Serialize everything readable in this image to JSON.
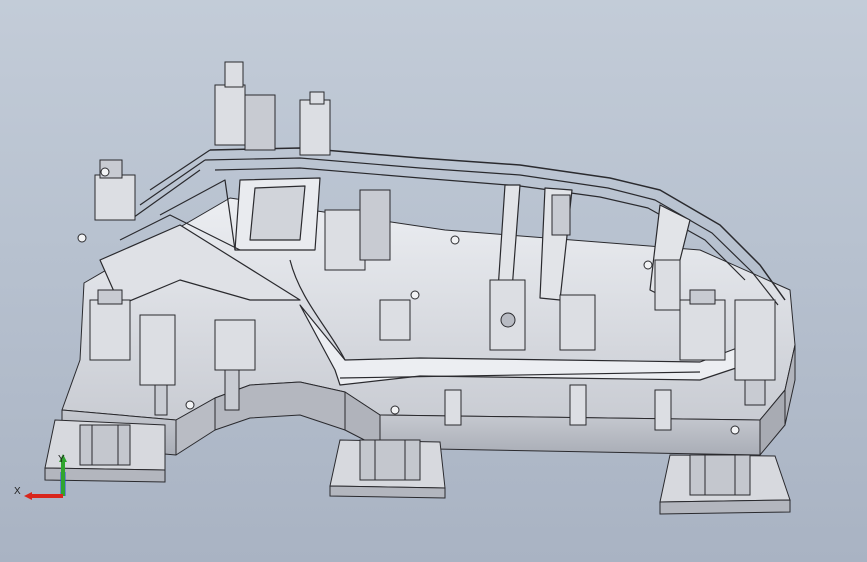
{
  "viewport": {
    "background_top": "#c3ccd8",
    "background_bottom": "#a9b3c3"
  },
  "model": {
    "face_color": "#d3d6dc",
    "face_light": "#e9ebef",
    "edge_color": "#2a2a2e",
    "shadow_color": "#9ea3ad"
  },
  "triad": {
    "x_label": "X",
    "y_label": "Y",
    "x_color": "#d8261c",
    "y_color": "#2fa52f",
    "z_color": "#1f4fd8"
  }
}
